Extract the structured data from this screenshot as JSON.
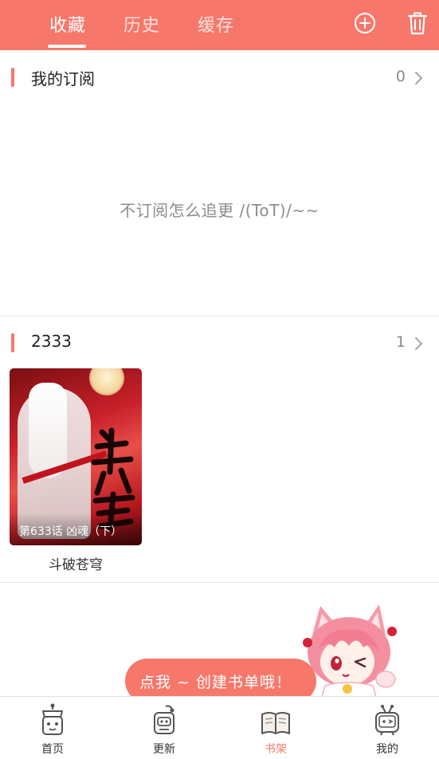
{
  "header": {
    "tabs": [
      {
        "label": "收藏",
        "active": true
      },
      {
        "label": "历史",
        "active": false
      },
      {
        "label": "缓存",
        "active": false
      }
    ],
    "icons": [
      "add-circle-icon",
      "trash-icon"
    ]
  },
  "subscriptions": {
    "title": "我的订阅",
    "count": "0",
    "empty_text": "不订阅怎么追更 /(ToT)/~~"
  },
  "booklist": {
    "title": "2333",
    "count": "1",
    "books": [
      {
        "title": "斗破苍穹",
        "chapter": "第633话 凶魂（下）"
      }
    ]
  },
  "create_prompt": {
    "label": "点我 ~ 创建书单哦！"
  },
  "bottom_nav": {
    "items": [
      {
        "label": "首页",
        "icon": "home-robot-icon",
        "active": false
      },
      {
        "label": "更新",
        "icon": "update-robot-icon",
        "active": false
      },
      {
        "label": "书架",
        "icon": "bookshelf-icon",
        "active": true
      },
      {
        "label": "我的",
        "icon": "profile-tv-icon",
        "active": false
      }
    ]
  },
  "colors": {
    "accent": "#f7776a",
    "text": "#222222",
    "muted": "#8c8c8c"
  }
}
